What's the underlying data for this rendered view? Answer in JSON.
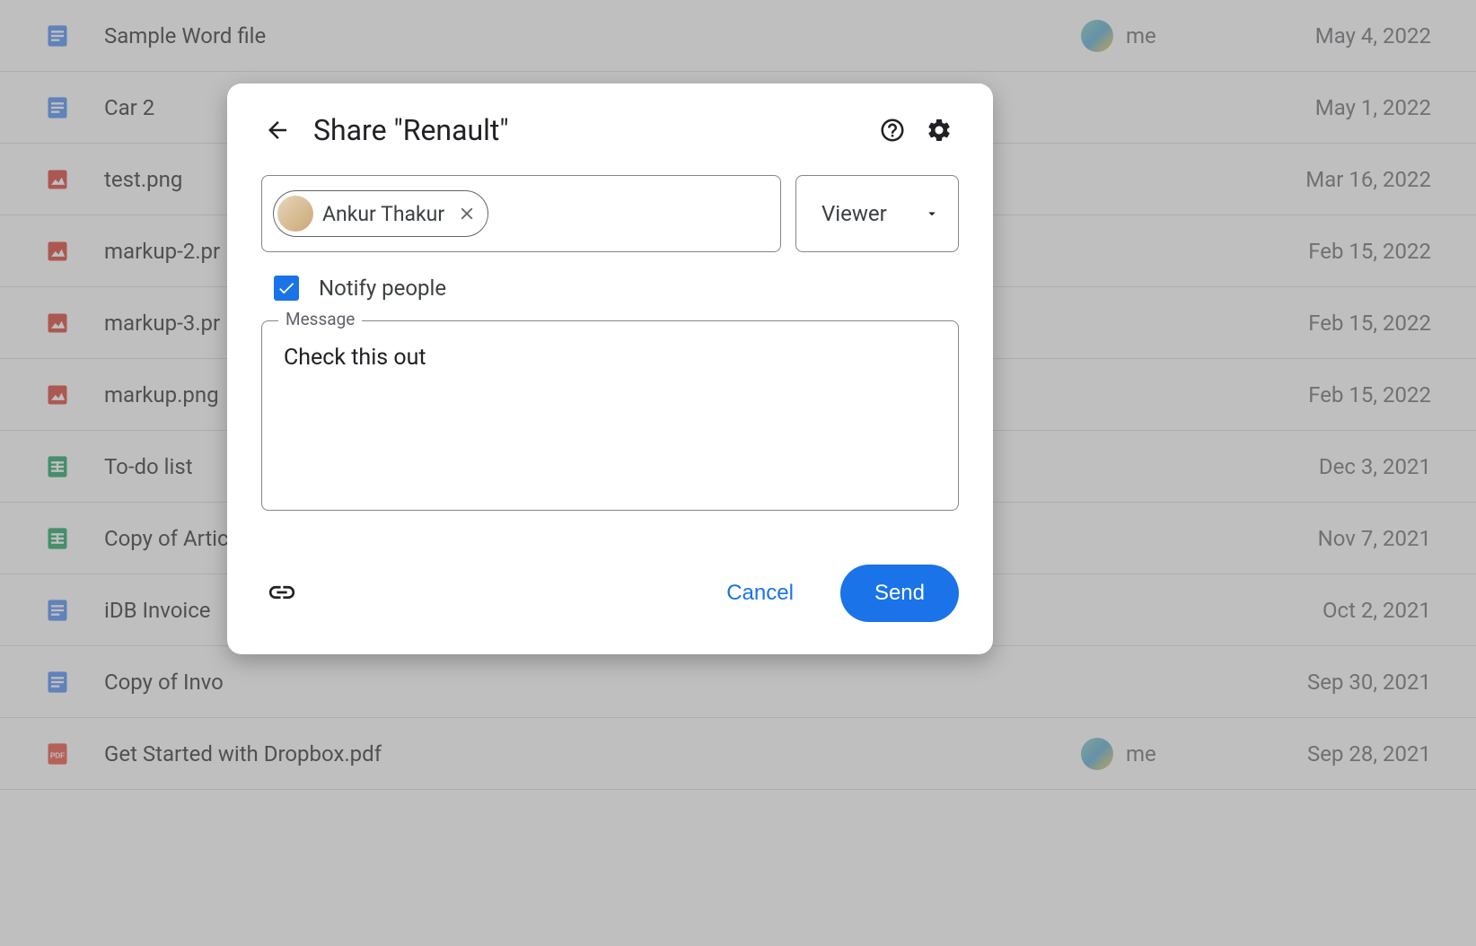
{
  "files": [
    {
      "name": "Sample Word file",
      "type": "doc",
      "owner": "me",
      "date": "May 4, 2022",
      "showOwner": true
    },
    {
      "name": "Car 2",
      "type": "doc",
      "owner": "",
      "date": "May 1, 2022",
      "showOwner": false
    },
    {
      "name": "test.png",
      "type": "image",
      "owner": "",
      "date": "Mar 16, 2022",
      "showOwner": false
    },
    {
      "name": "markup-2.pr",
      "type": "image",
      "owner": "",
      "date": "Feb 15, 2022",
      "showOwner": false
    },
    {
      "name": "markup-3.pr",
      "type": "image",
      "owner": "",
      "date": "Feb 15, 2022",
      "showOwner": false
    },
    {
      "name": "markup.png",
      "type": "image",
      "owner": "",
      "date": "Feb 15, 2022",
      "showOwner": false
    },
    {
      "name": "To-do list",
      "type": "sheet",
      "owner": "",
      "date": "Dec 3, 2021",
      "showOwner": false
    },
    {
      "name": "Copy of Artic",
      "type": "sheet",
      "owner": "",
      "date": "Nov 7, 2021",
      "showOwner": false
    },
    {
      "name": "iDB Invoice",
      "type": "doc",
      "owner": "",
      "date": "Oct 2, 2021",
      "showOwner": false
    },
    {
      "name": "Copy of Invo",
      "type": "doc",
      "owner": "",
      "date": "Sep 30, 2021",
      "showOwner": false
    },
    {
      "name": "Get Started with Dropbox.pdf",
      "type": "pdf",
      "owner": "me",
      "date": "Sep 28, 2021",
      "showOwner": true
    }
  ],
  "dialog": {
    "title": "Share \"Renault\"",
    "chip_name": "Ankur Thakur",
    "role": "Viewer",
    "notify_label": "Notify people",
    "notify_checked": true,
    "message_legend": "Message",
    "message_value": "Check this out",
    "cancel_label": "Cancel",
    "send_label": "Send"
  }
}
